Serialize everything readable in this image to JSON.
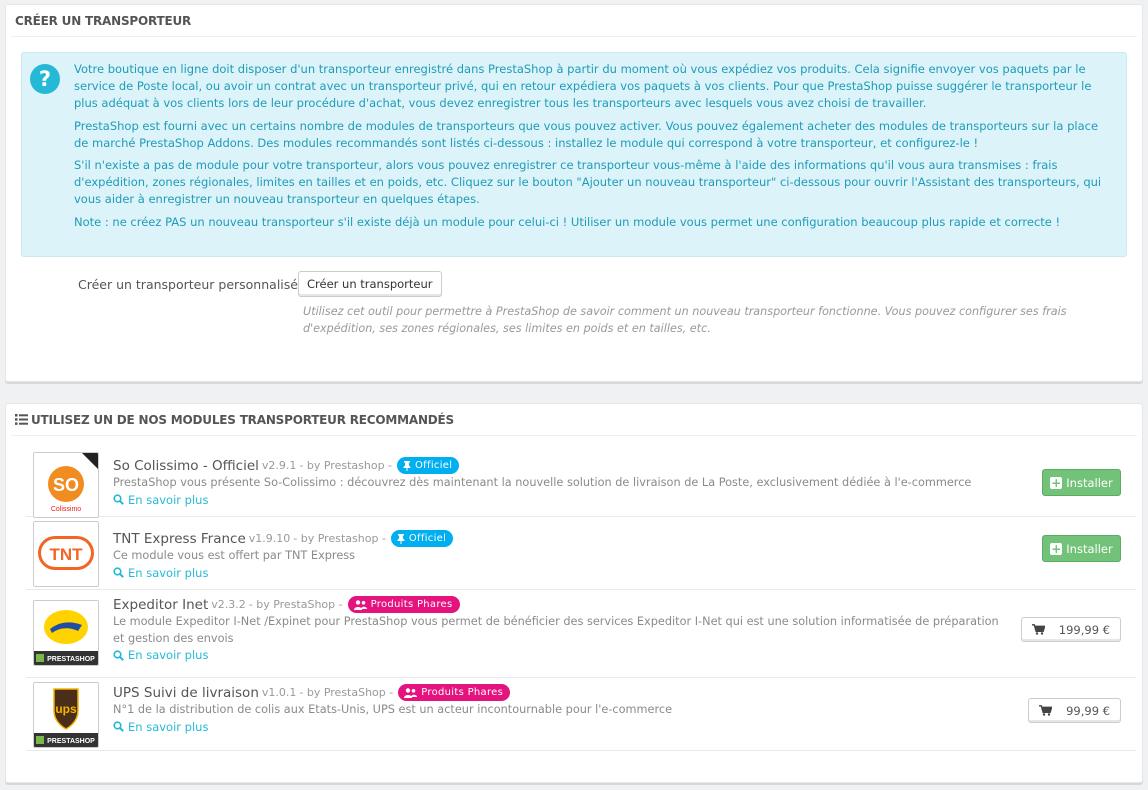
{
  "create_panel": {
    "title": "CRÉER UN TRANSPORTEUR",
    "info_paragraphs": [
      "Votre boutique en ligne doit disposer d'un transporteur enregistré dans PrestaShop à partir du moment où vous expédiez vos produits. Cela signifie envoyer vos paquets par le service de Poste local, ou avoir un contrat avec un transporteur privé, qui en retour expédiera vos paquets à vos clients. Pour que PrestaShop puisse suggérer le transporteur le plus adéquat à vos clients lors de leur procédure d'achat, vous devez enregistrer tous les transporteurs avec lesquels vous avez choisi de travailler.",
      "PrestaShop est fourni avec un certains nombre de modules de transporteurs que vous pouvez activer. Vous pouvez également acheter des modules de transporteurs sur la place de marché PrestaShop Addons. Des modules recommandés sont listés ci-dessous : installez le module qui correspond à votre transporteur, et configurez-le !",
      "S'il n'existe a pas de module pour votre transporteur, alors vous pouvez enregistrer ce transporteur vous-même à l'aide des informations qu'il vous aura transmises : frais d'expédition, zones régionales, limites en tailles et en poids, etc. Cliquez sur le bouton \"Ajouter un nouveau transporteur\" ci-dessous pour ouvrir l'Assistant des transporteurs, qui vous aider à enregistrer un nouveau transporteur en quelques étapes.",
      "Note : ne créez PAS un nouveau transporteur s'il existe déjà un module pour celui-ci ! Utiliser un module vous permet une configuration beaucoup plus rapide et correcte !"
    ],
    "info_icon": "?",
    "custom_label": "Créer un transporteur personnalisé",
    "custom_button": "Créer un transporteur",
    "help_text": "Utilisez cet outil pour permettre à PrestaShop de savoir comment un nouveau transporteur fonctionne. Vous pouvez configurer ses frais d'expédition, ses zones régionales, ses limites en poids et en tailles, etc."
  },
  "modules_panel": {
    "title": "UTILISEZ UN DE NOS MODULES TRANSPORTEUR RECOMMANDÉS",
    "icon": "list-icon",
    "modules": [
      {
        "name": "So Colissimo - Officiel",
        "version": "v2.9.1",
        "author": "- by Prestashop -",
        "badge": "Officiel",
        "badge_type": "official",
        "description": "PrestaShop vous présente So-Colissimo : découvrez dès maintenant la nouvelle solution de livraison de La Poste, exclusivement dédiée à l'e-commerce",
        "more": "En savoir plus",
        "action": "Installer",
        "action_type": "install",
        "logo": "colissimo",
        "logo_text": "Colissimo",
        "logo_mark": "SO"
      },
      {
        "name": "TNT Express France",
        "version": "v1.9.10",
        "author": "- by Prestashop -",
        "badge": "Officiel",
        "badge_type": "official",
        "description": "Ce module vous est offert par TNT Express",
        "more": "En savoir plus",
        "action": "Installer",
        "action_type": "install",
        "logo": "tnt",
        "logo_text": "TNT"
      },
      {
        "name": "Expeditor Inet",
        "version": "v2.3.2",
        "author": "- by PrestaShop -",
        "badge": "Produits Phares",
        "badge_type": "phares",
        "description": "Le module Expeditor I-Net /Expinet pour PrestaShop vous permet de bénéficier des services Expeditor I-Net qui est une solution informatisée de préparation et gestion des envois",
        "more": "En savoir plus",
        "action": "199,99 €",
        "action_type": "buy",
        "logo": "laposte",
        "logo_text": "PRESTASHOP"
      },
      {
        "name": "UPS Suivi de livraison",
        "version": "v1.0.1",
        "author": "- by PrestaShop -",
        "badge": "Produits Phares",
        "badge_type": "phares",
        "description": "N°1 de la distribution de colis aux Etats-Unis, UPS est un acteur incontournable pour l'e-commerce",
        "more": "En savoir plus",
        "action": "99,99 €",
        "action_type": "buy",
        "logo": "ups",
        "logo_text": "PRESTASHOP",
        "logo_mark": "ups"
      }
    ]
  },
  "colors": {
    "info_text": "#1f9bb8",
    "info_bg": "#dcf4f9",
    "official_badge": "#00aff0",
    "phares_badge": "#e4137e",
    "install_green": "#72c279",
    "link": "#25b9d7"
  }
}
